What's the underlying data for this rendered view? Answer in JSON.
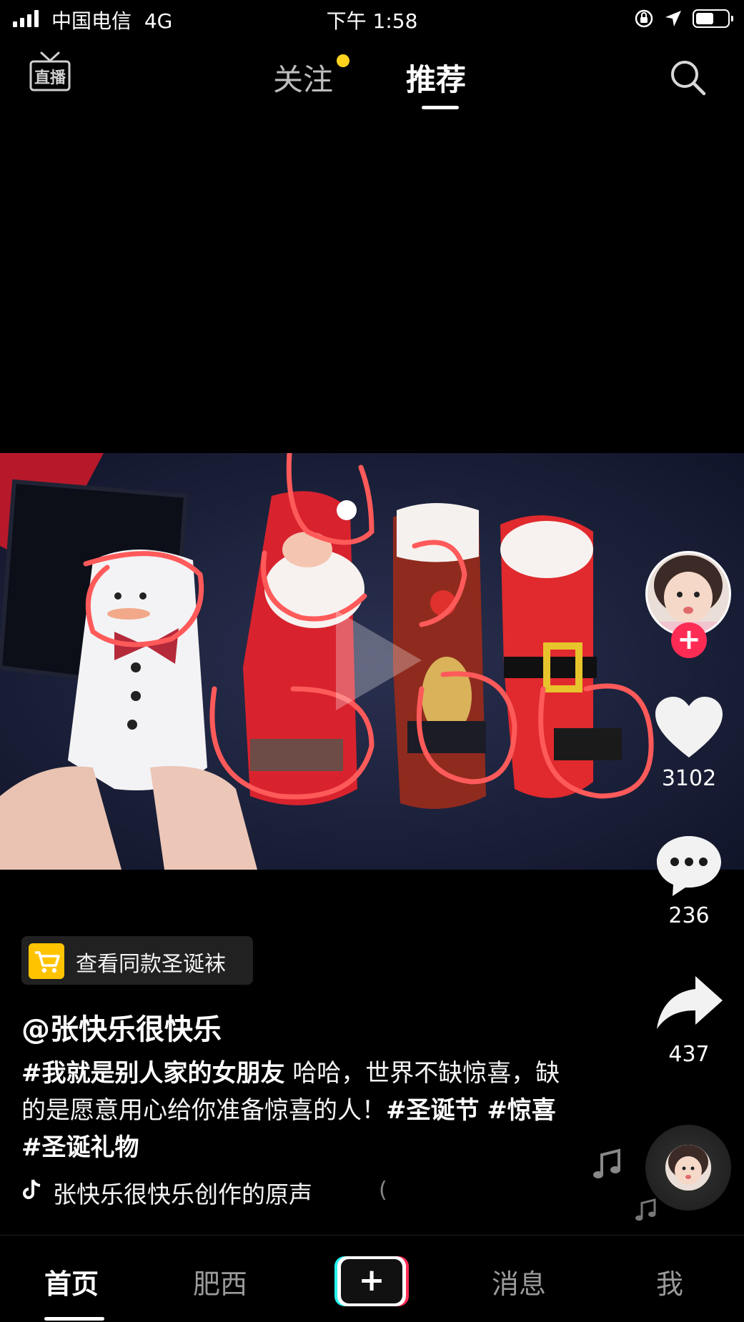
{
  "status_bar": {
    "carrier": "中国电信",
    "network": "4G",
    "time": "下午 1:58"
  },
  "top_nav": {
    "live_icon": "live-broadcast-icon",
    "tabs": [
      {
        "label": "关注",
        "active": false,
        "has_dot": true
      },
      {
        "label": "推荐",
        "active": true
      }
    ],
    "search_icon": "search-icon"
  },
  "video": {
    "description_visual": "christmas-socks-video",
    "play_icon": "play-icon"
  },
  "side_actions": {
    "avatar_icon": "author-avatar",
    "follow_label": "+",
    "likes": "3102",
    "comments": "236",
    "shares": "437"
  },
  "info": {
    "shop_label": "查看同款圣诞袜",
    "author": "@张快乐很快乐",
    "description_tag": "#我就是别人家的女朋友",
    "description_text_1": " 哈哈，世界不缺惊喜，缺的是愿意用心给你准备惊喜的人！",
    "description_tag_2": "#圣诞节",
    "description_tag_3": "#惊喜",
    "description_tag_4": "#圣诞礼物",
    "music": "张快乐很快乐创作的原声",
    "music_tail": "("
  },
  "tab_bar": {
    "home": "首页",
    "feisi": "肥西",
    "add": "+",
    "messages": "消息",
    "me": "我"
  },
  "colors": {
    "accent": "#fe2c55",
    "notify_dot": "#ffd21e",
    "shop_yellow": "#ffc300"
  }
}
